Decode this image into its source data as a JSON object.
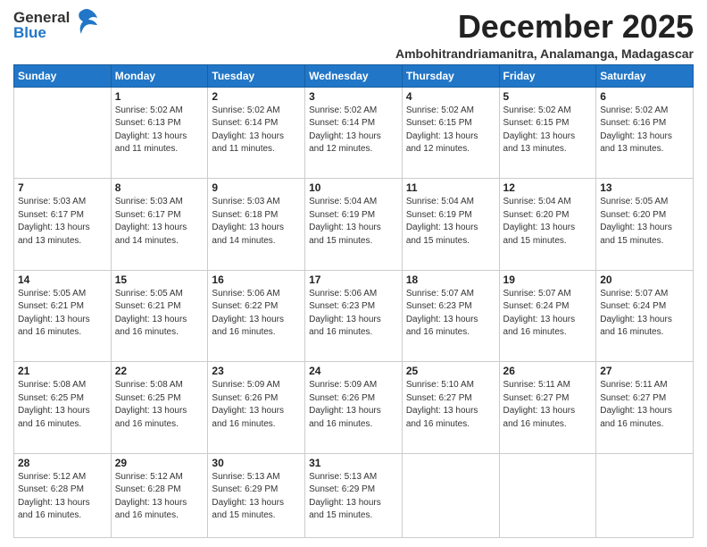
{
  "logo": {
    "line1": "General",
    "line2": "Blue"
  },
  "title": "December 2025",
  "subtitle": "Ambohitrandriamanitra, Analamanga, Madagascar",
  "days_of_week": [
    "Sunday",
    "Monday",
    "Tuesday",
    "Wednesday",
    "Thursday",
    "Friday",
    "Saturday"
  ],
  "weeks": [
    [
      {
        "day": "",
        "info": ""
      },
      {
        "day": "1",
        "info": "Sunrise: 5:02 AM\nSunset: 6:13 PM\nDaylight: 13 hours\nand 11 minutes."
      },
      {
        "day": "2",
        "info": "Sunrise: 5:02 AM\nSunset: 6:14 PM\nDaylight: 13 hours\nand 11 minutes."
      },
      {
        "day": "3",
        "info": "Sunrise: 5:02 AM\nSunset: 6:14 PM\nDaylight: 13 hours\nand 12 minutes."
      },
      {
        "day": "4",
        "info": "Sunrise: 5:02 AM\nSunset: 6:15 PM\nDaylight: 13 hours\nand 12 minutes."
      },
      {
        "day": "5",
        "info": "Sunrise: 5:02 AM\nSunset: 6:15 PM\nDaylight: 13 hours\nand 13 minutes."
      },
      {
        "day": "6",
        "info": "Sunrise: 5:02 AM\nSunset: 6:16 PM\nDaylight: 13 hours\nand 13 minutes."
      }
    ],
    [
      {
        "day": "7",
        "info": "Sunrise: 5:03 AM\nSunset: 6:17 PM\nDaylight: 13 hours\nand 13 minutes."
      },
      {
        "day": "8",
        "info": "Sunrise: 5:03 AM\nSunset: 6:17 PM\nDaylight: 13 hours\nand 14 minutes."
      },
      {
        "day": "9",
        "info": "Sunrise: 5:03 AM\nSunset: 6:18 PM\nDaylight: 13 hours\nand 14 minutes."
      },
      {
        "day": "10",
        "info": "Sunrise: 5:04 AM\nSunset: 6:19 PM\nDaylight: 13 hours\nand 15 minutes."
      },
      {
        "day": "11",
        "info": "Sunrise: 5:04 AM\nSunset: 6:19 PM\nDaylight: 13 hours\nand 15 minutes."
      },
      {
        "day": "12",
        "info": "Sunrise: 5:04 AM\nSunset: 6:20 PM\nDaylight: 13 hours\nand 15 minutes."
      },
      {
        "day": "13",
        "info": "Sunrise: 5:05 AM\nSunset: 6:20 PM\nDaylight: 13 hours\nand 15 minutes."
      }
    ],
    [
      {
        "day": "14",
        "info": "Sunrise: 5:05 AM\nSunset: 6:21 PM\nDaylight: 13 hours\nand 16 minutes."
      },
      {
        "day": "15",
        "info": "Sunrise: 5:05 AM\nSunset: 6:21 PM\nDaylight: 13 hours\nand 16 minutes."
      },
      {
        "day": "16",
        "info": "Sunrise: 5:06 AM\nSunset: 6:22 PM\nDaylight: 13 hours\nand 16 minutes."
      },
      {
        "day": "17",
        "info": "Sunrise: 5:06 AM\nSunset: 6:23 PM\nDaylight: 13 hours\nand 16 minutes."
      },
      {
        "day": "18",
        "info": "Sunrise: 5:07 AM\nSunset: 6:23 PM\nDaylight: 13 hours\nand 16 minutes."
      },
      {
        "day": "19",
        "info": "Sunrise: 5:07 AM\nSunset: 6:24 PM\nDaylight: 13 hours\nand 16 minutes."
      },
      {
        "day": "20",
        "info": "Sunrise: 5:07 AM\nSunset: 6:24 PM\nDaylight: 13 hours\nand 16 minutes."
      }
    ],
    [
      {
        "day": "21",
        "info": "Sunrise: 5:08 AM\nSunset: 6:25 PM\nDaylight: 13 hours\nand 16 minutes."
      },
      {
        "day": "22",
        "info": "Sunrise: 5:08 AM\nSunset: 6:25 PM\nDaylight: 13 hours\nand 16 minutes."
      },
      {
        "day": "23",
        "info": "Sunrise: 5:09 AM\nSunset: 6:26 PM\nDaylight: 13 hours\nand 16 minutes."
      },
      {
        "day": "24",
        "info": "Sunrise: 5:09 AM\nSunset: 6:26 PM\nDaylight: 13 hours\nand 16 minutes."
      },
      {
        "day": "25",
        "info": "Sunrise: 5:10 AM\nSunset: 6:27 PM\nDaylight: 13 hours\nand 16 minutes."
      },
      {
        "day": "26",
        "info": "Sunrise: 5:11 AM\nSunset: 6:27 PM\nDaylight: 13 hours\nand 16 minutes."
      },
      {
        "day": "27",
        "info": "Sunrise: 5:11 AM\nSunset: 6:27 PM\nDaylight: 13 hours\nand 16 minutes."
      }
    ],
    [
      {
        "day": "28",
        "info": "Sunrise: 5:12 AM\nSunset: 6:28 PM\nDaylight: 13 hours\nand 16 minutes."
      },
      {
        "day": "29",
        "info": "Sunrise: 5:12 AM\nSunset: 6:28 PM\nDaylight: 13 hours\nand 16 minutes."
      },
      {
        "day": "30",
        "info": "Sunrise: 5:13 AM\nSunset: 6:29 PM\nDaylight: 13 hours\nand 15 minutes."
      },
      {
        "day": "31",
        "info": "Sunrise: 5:13 AM\nSunset: 6:29 PM\nDaylight: 13 hours\nand 15 minutes."
      },
      {
        "day": "",
        "info": ""
      },
      {
        "day": "",
        "info": ""
      },
      {
        "day": "",
        "info": ""
      }
    ]
  ]
}
